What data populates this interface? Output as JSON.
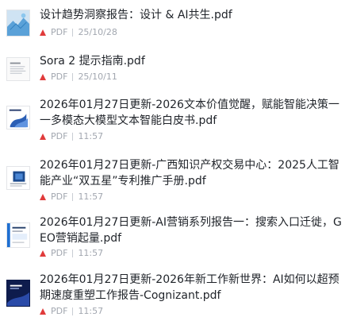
{
  "files": [
    {
      "title": "设计趋势洞察报告：设计 & AI共生.pdf",
      "type": "PDF",
      "time": "25/10/28"
    },
    {
      "title": "Sora 2 提示指南.pdf",
      "type": "PDF",
      "time": "25/10/11"
    },
    {
      "title": "2026年01月27日更新-2026文本价值觉醒，赋能智能决策一一多模态大模型文本智能白皮书.pdf",
      "type": "PDF",
      "time": "11:57"
    },
    {
      "title": "2026年01月27日更新-广西知识产权交易中心：2025人工智能产业“双五星”专利推广手册.pdf",
      "type": "PDF",
      "time": "11:57"
    },
    {
      "title": "2026年01月27日更新-AI营销系列报告一：搜索入口迁徙，GEO营销起量.pdf",
      "type": "PDF",
      "time": "11:57"
    },
    {
      "title": "2026年01月27日更新-2026年新工作新世界：AI如何以超预期速度重塑工作报告-Cognizant.pdf",
      "type": "PDF",
      "time": "11:57"
    }
  ]
}
